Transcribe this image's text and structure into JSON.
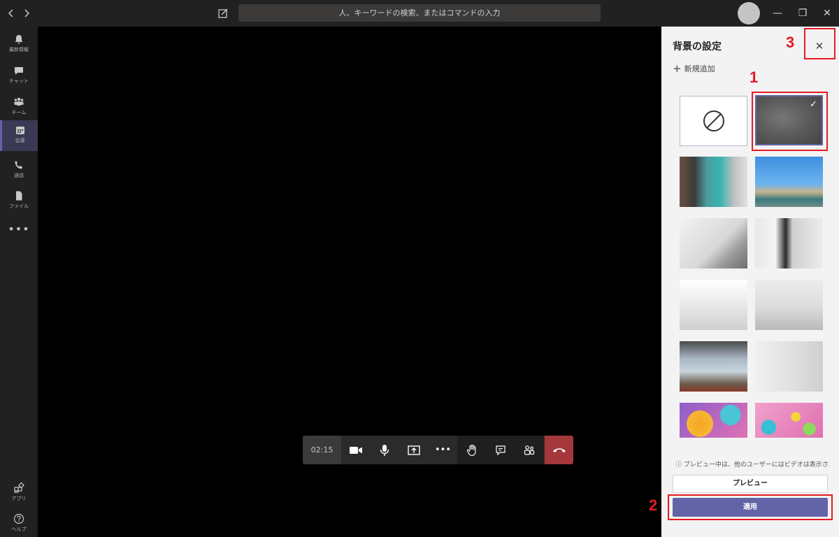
{
  "titlebar": {
    "back_icon": "chevron-left-icon",
    "forward_icon": "chevron-right-icon",
    "compose_icon": "compose-icon",
    "search_placeholder": "人、キーワードの検索、またはコマンドの入力",
    "minimize": "—",
    "restore": "❐",
    "close": "✕"
  },
  "rail": {
    "items": [
      {
        "label": "最新情報",
        "icon": "bell-icon"
      },
      {
        "label": "チャット",
        "icon": "chat-icon"
      },
      {
        "label": "チーム",
        "icon": "teams-icon"
      },
      {
        "label": "会議",
        "icon": "calendar-icon",
        "active": true
      },
      {
        "label": "通話",
        "icon": "phone-icon"
      },
      {
        "label": "ファイル",
        "icon": "file-icon"
      }
    ],
    "more": "•••",
    "apps_label": "アプリ",
    "help_label": "ヘルプ"
  },
  "call": {
    "timer": "02:15",
    "more": "•••"
  },
  "panel": {
    "title": "背景の設定",
    "close": "✕",
    "add_new": "新規追加",
    "add_icon": "plus-icon",
    "selected_check": "✓",
    "info_text": "プレビュー中は、他のユーザーにはビデオは表示されま...",
    "preview_label": "プレビュー",
    "apply_label": "適用"
  },
  "annotations": {
    "one": "1",
    "two": "2",
    "three": "3"
  },
  "colors": {
    "accent": "#6264a7",
    "hangup": "#a4373a",
    "annotation": "#e31b23"
  }
}
